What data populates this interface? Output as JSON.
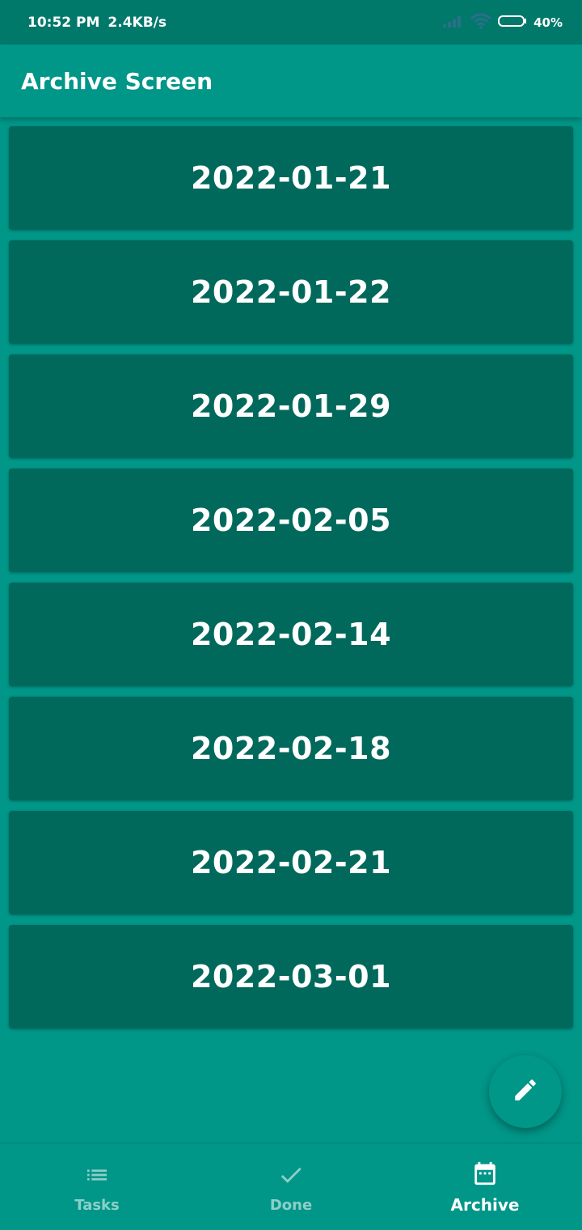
{
  "status_bar": {
    "time": "10:52 PM",
    "speed": "2.4KB/s",
    "battery": "40%",
    "icons": [
      "signal-icon",
      "wifi-icon",
      "battery-icon"
    ]
  },
  "app_bar": {
    "title": "Archive Screen"
  },
  "archive_dates": [
    "2022-01-21",
    "2022-01-22",
    "2022-01-29",
    "2022-02-05",
    "2022-02-14",
    "2022-02-18",
    "2022-02-21",
    "2022-03-01"
  ],
  "fab": {
    "icon": "edit-icon"
  },
  "bottom_nav": {
    "items": [
      {
        "label": "Tasks",
        "icon": "list-icon",
        "active": false
      },
      {
        "label": "Done",
        "icon": "check-icon",
        "active": false
      },
      {
        "label": "Archive",
        "icon": "calendar-icon",
        "active": true
      }
    ]
  },
  "colors": {
    "primary": "#009688",
    "status_bar": "#00796b",
    "card": "#00695c"
  }
}
